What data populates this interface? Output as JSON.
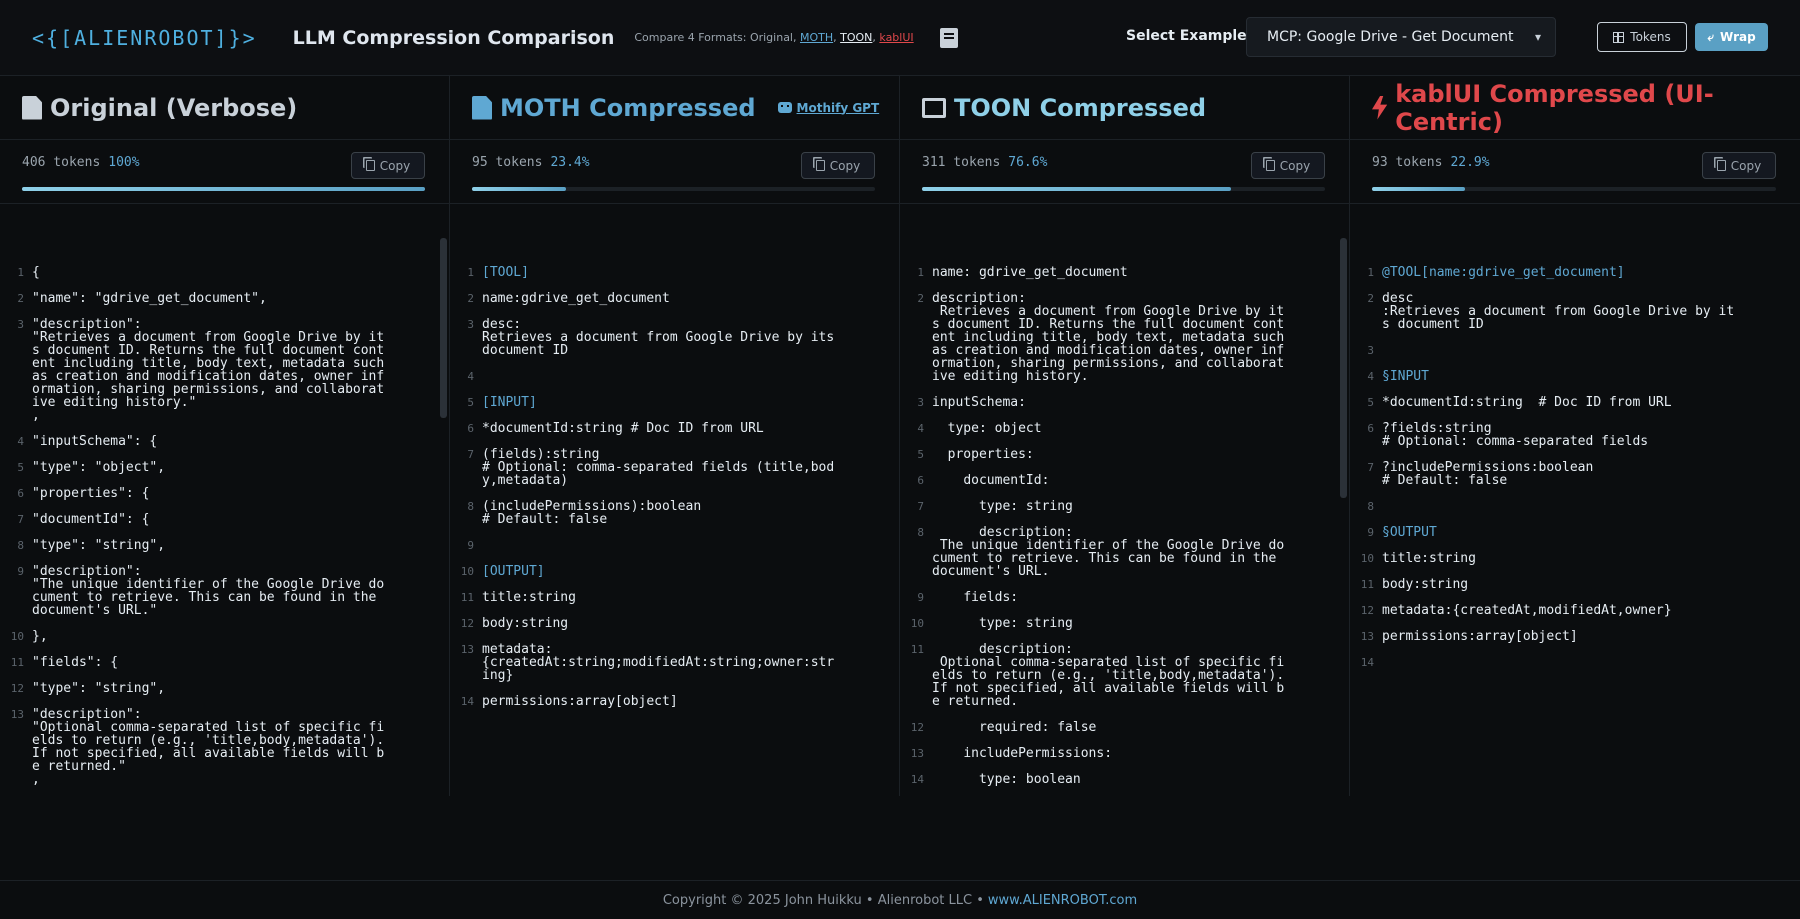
{
  "header": {
    "logo": "<{[ALIENROBOT]}>",
    "title": "LLM Compression Comparison",
    "subtitle_prefix": "Compare 4 Formats: Original, ",
    "fmt_moth": "MOTH",
    "fmt_toon": "TOON",
    "fmt_kabl": "kablUI",
    "select_label": "Select Example:",
    "select_value": "MCP: Google Drive - Get Document",
    "tokens_btn": "Tokens",
    "wrap_btn": "Wrap"
  },
  "columns": [
    {
      "title": "Original (Verbose)",
      "title_color": "#c9d1d9",
      "icon": "file-icon",
      "tokens": "406 tokens",
      "pct": "100%",
      "progress": 1.0,
      "copy": "Copy"
    },
    {
      "title": "MOTH Compressed",
      "title_color": "#5fa8d3",
      "icon": "code-file-icon",
      "gpt_link": "Mothify GPT",
      "tokens": "95 tokens",
      "pct": "23.4%",
      "progress": 0.234,
      "copy": "Copy"
    },
    {
      "title": "TOON Compressed",
      "title_color": "#8fd0e8",
      "icon": "table-icon",
      "tokens": "311 tokens",
      "pct": "76.6%",
      "progress": 0.766,
      "copy": "Copy"
    },
    {
      "title": "kablUI Compressed (UI-Centric)",
      "title_color": "#e0484b",
      "icon": "bolt-icon",
      "tokens": "93 tokens",
      "pct": "22.9%",
      "progress": 0.229,
      "copy": "Copy"
    }
  ],
  "code": {
    "original": [
      {
        "n": "1",
        "t": "{"
      },
      {
        "n": "2",
        "t": "\"name\": \"gdrive_get_document\","
      },
      {
        "n": "3",
        "t": "\"description\":\n\"Retrieves a document from Google Drive by its document ID. Returns the full document content including title, body text, metadata such as creation and modification dates, owner information, sharing permissions, and collaborative editing history.\"\n,"
      },
      {
        "n": "4",
        "t": "\"inputSchema\": {"
      },
      {
        "n": "5",
        "t": "\"type\": \"object\","
      },
      {
        "n": "6",
        "t": "\"properties\": {"
      },
      {
        "n": "7",
        "t": "\"documentId\": {"
      },
      {
        "n": "8",
        "t": "\"type\": \"string\","
      },
      {
        "n": "9",
        "t": "\"description\":\n\"The unique identifier of the Google Drive document to retrieve. This can be found in the document's URL.\""
      },
      {
        "n": "10",
        "t": "},"
      },
      {
        "n": "11",
        "t": "\"fields\": {"
      },
      {
        "n": "12",
        "t": "\"type\": \"string\","
      },
      {
        "n": "13",
        "t": "\"description\":\n\"Optional comma-separated list of specific fields to return (e.g., 'title,body,metadata'). If not specified, all available fields will be returned.\"\n,"
      }
    ],
    "moth": [
      {
        "n": "1",
        "t": "[TOOL]"
      },
      {
        "n": "2",
        "t": "name:gdrive_get_document"
      },
      {
        "n": "3",
        "t": "desc:\nRetrieves a document from Google Drive by its document ID"
      },
      {
        "n": "4",
        "t": ""
      },
      {
        "n": "5",
        "t": "[INPUT]"
      },
      {
        "n": "6",
        "t": "*documentId:string # Doc ID from URL"
      },
      {
        "n": "7",
        "t": "(fields):string\n# Optional: comma-separated fields (title,body,metadata)"
      },
      {
        "n": "8",
        "t": "(includePermissions):boolean\n# Default: false"
      },
      {
        "n": "9",
        "t": ""
      },
      {
        "n": "10",
        "t": "[OUTPUT]"
      },
      {
        "n": "11",
        "t": "title:string"
      },
      {
        "n": "12",
        "t": "body:string"
      },
      {
        "n": "13",
        "t": "metadata:\n{createdAt:string;modifiedAt:string;owner:string}"
      },
      {
        "n": "14",
        "t": "permissions:array[object]"
      }
    ],
    "toon": [
      {
        "n": "1",
        "t": "name: gdrive_get_document"
      },
      {
        "n": "2",
        "t": "description:\n Retrieves a document from Google Drive by its document ID. Returns the full document content including title, body text, metadata such as creation and modification dates, owner information, sharing permissions, and collaborative editing history."
      },
      {
        "n": "3",
        "t": "inputSchema:"
      },
      {
        "n": "4",
        "t": "  type: object"
      },
      {
        "n": "5",
        "t": "  properties:"
      },
      {
        "n": "6",
        "t": "    documentId:"
      },
      {
        "n": "7",
        "t": "      type: string"
      },
      {
        "n": "8",
        "t": "      description:\n The unique identifier of the Google Drive document to retrieve. This can be found in the document's URL."
      },
      {
        "n": "9",
        "t": "    fields:"
      },
      {
        "n": "10",
        "t": "      type: string"
      },
      {
        "n": "11",
        "t": "      description:\n Optional comma-separated list of specific fields to return (e.g., 'title,body,metadata'). If not specified, all available fields will be returned."
      },
      {
        "n": "12",
        "t": "      required: false"
      },
      {
        "n": "13",
        "t": "    includePermissions:"
      },
      {
        "n": "14",
        "t": "      type: boolean"
      }
    ],
    "kabl": [
      {
        "n": "1",
        "t": "@TOOL[name:gdrive_get_document]"
      },
      {
        "n": "2",
        "t": "desc\n:Retrieves a document from Google Drive by its document ID"
      },
      {
        "n": "3",
        "t": ""
      },
      {
        "n": "4",
        "t": "§INPUT"
      },
      {
        "n": "5",
        "t": "*documentId:string  # Doc ID from URL"
      },
      {
        "n": "6",
        "t": "?fields:string\n# Optional: comma-separated fields"
      },
      {
        "n": "7",
        "t": "?includePermissions:boolean\n# Default: false"
      },
      {
        "n": "8",
        "t": ""
      },
      {
        "n": "9",
        "t": "§OUTPUT"
      },
      {
        "n": "10",
        "t": "title:string"
      },
      {
        "n": "11",
        "t": "body:string"
      },
      {
        "n": "12",
        "t": "metadata:{createdAt,modifiedAt,owner}"
      },
      {
        "n": "13",
        "t": "permissions:array[object]"
      },
      {
        "n": "14",
        "t": ""
      }
    ]
  },
  "footer": {
    "copyright": "Copyright © 2025 John Huikku • Alienrobot LLC •",
    "site": "www.ALIENROBOT.com"
  }
}
